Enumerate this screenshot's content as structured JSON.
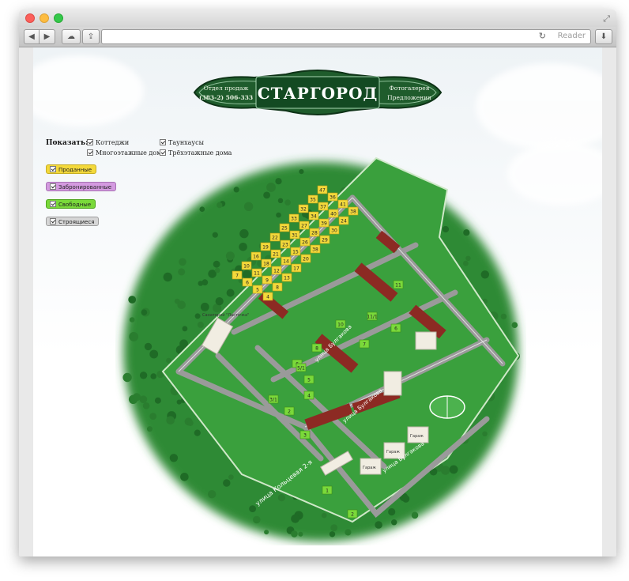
{
  "browser": {
    "reader_label": "Reader"
  },
  "header": {
    "phone_line1": "Отдел продаж",
    "phone_line2": "(383-2) 506-333",
    "logo_title": "СТАРГОРОД",
    "link_gallery": "Фотогалерея",
    "link_offers": "Предложения"
  },
  "filters": {
    "show_label": "Показать:",
    "types": [
      {
        "label": "Коттеджи",
        "checked": true
      },
      {
        "label": "Таунхаусы",
        "checked": true
      },
      {
        "label": "Многоэтажные дома",
        "checked": true
      },
      {
        "label": "Трёхэтажные дома",
        "checked": true
      }
    ],
    "statuses": [
      {
        "label": "Проданные",
        "checked": true,
        "color": "#f3d93b"
      },
      {
        "label": "Забронированные",
        "checked": true,
        "color": "#d49ae0"
      },
      {
        "label": "Свободные",
        "checked": true,
        "color": "#7ad93a"
      },
      {
        "label": "Строящиеся",
        "checked": true,
        "color": "#d6d6d6"
      }
    ]
  },
  "map": {
    "streets": [
      "улица Кольцевая 2-я",
      "улица Булгакова",
      "улица Булгакова",
      "улица Булгакова"
    ],
    "sold_lots": [
      "47",
      "36",
      "41",
      "38",
      "35",
      "37",
      "40",
      "24",
      "32",
      "34",
      "39",
      "30",
      "33",
      "27",
      "28",
      "29",
      "25",
      "31",
      "26",
      "38",
      "22",
      "23",
      "15",
      "20",
      "19",
      "21",
      "14",
      "17",
      "16",
      "18",
      "12",
      "13",
      "10",
      "11",
      "9",
      "8",
      "7",
      "6",
      "5",
      "4"
    ],
    "free_lots": [
      "11",
      "11/1",
      "6",
      "10",
      "7",
      "8",
      "6",
      "5",
      "5/1",
      "4",
      "3/1",
      "2",
      "3",
      "1",
      "2"
    ],
    "labels": [
      "Санаторий \"Ласточка\"",
      "Гараж",
      "Гараж",
      "Гараж"
    ]
  },
  "colors": {
    "grass": "#2f8a34",
    "road": "#9a9a9a",
    "sold": "#f3d93b",
    "free": "#7ad93a",
    "logo_green": "#1f5c2c"
  }
}
